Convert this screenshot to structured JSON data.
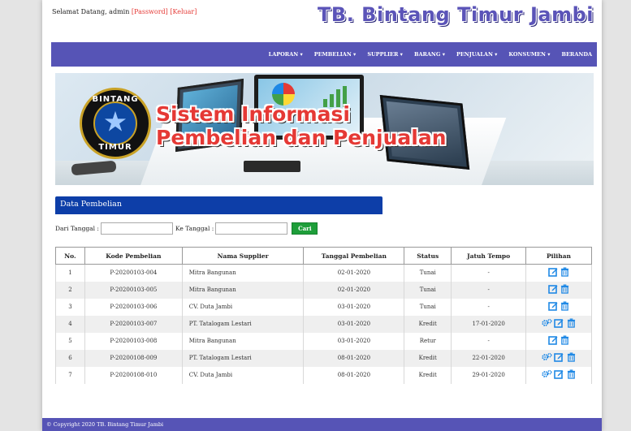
{
  "header": {
    "greeting": "Selamat Datang, admin",
    "password_link": "[Password]",
    "logout_link": "[Keluar]",
    "brand": "TB. Bintang Timur Jambi"
  },
  "nav": {
    "items": [
      {
        "label": "LAPORAN ▾"
      },
      {
        "label": "PEMBELIAN ▾"
      },
      {
        "label": "SUPPLIER ▾"
      },
      {
        "label": "BARANG ▾"
      },
      {
        "label": "PENJUALAN ▾"
      },
      {
        "label": "KONSUMEN ▾"
      },
      {
        "label": "BERANDA"
      }
    ]
  },
  "banner": {
    "logo_top": "BINTANG",
    "logo_bottom": "TIMUR",
    "title_line1": "Sistem Informasi",
    "title_line2": "Pembelian dan Penjualan"
  },
  "section": {
    "title": "Data Pembelian"
  },
  "filter": {
    "from_label": "Dari Tanggal :",
    "from_value": "",
    "to_label": "Ke Tanggal :",
    "to_value": "",
    "search_label": "Cari"
  },
  "table": {
    "columns": [
      "No.",
      "Kode Pembelian",
      "Nama Supplier",
      "Tanggal Pembelian",
      "Status",
      "Jatuh Tempo",
      "Pilihan"
    ],
    "rows": [
      {
        "no": "1",
        "kode": "P-20200103-004",
        "supplier": "Mitra Bangunan",
        "tanggal": "02-01-2020",
        "status": "Tunai",
        "jatuh_tempo": "-",
        "detail": false
      },
      {
        "no": "2",
        "kode": "P-20200103-005",
        "supplier": "Mitra Bangunan",
        "tanggal": "02-01-2020",
        "status": "Tunai",
        "jatuh_tempo": "-",
        "detail": false
      },
      {
        "no": "3",
        "kode": "P-20200103-006",
        "supplier": "CV. Duta Jambi",
        "tanggal": "03-01-2020",
        "status": "Tunai",
        "jatuh_tempo": "-",
        "detail": false
      },
      {
        "no": "4",
        "kode": "P-20200103-007",
        "supplier": "PT. Tatalogam Lestari",
        "tanggal": "03-01-2020",
        "status": "Kredit",
        "jatuh_tempo": "17-01-2020",
        "detail": true
      },
      {
        "no": "5",
        "kode": "P-20200103-008",
        "supplier": "Mitra Bangunan",
        "tanggal": "03-01-2020",
        "status": "Retur",
        "jatuh_tempo": "-",
        "detail": false
      },
      {
        "no": "6",
        "kode": "P-20200108-009",
        "supplier": "PT. Tatalogam Lestari",
        "tanggal": "08-01-2020",
        "status": "Kredit",
        "jatuh_tempo": "22-01-2020",
        "detail": true
      },
      {
        "no": "7",
        "kode": "P-20200108-010",
        "supplier": "CV. Duta Jambi",
        "tanggal": "08-01-2020",
        "status": "Kredit",
        "jatuh_tempo": "29-01-2020",
        "detail": true
      }
    ]
  },
  "footer": {
    "copyright": "© Copyright 2020 TB. Bintang Timur Jambi"
  },
  "colors": {
    "nav_bg": "#5654b6",
    "section_bg": "#0d3ea8",
    "search_button": "#1e9e3a",
    "title_red": "#e53935",
    "icon_blue": "#1e88e5"
  },
  "icons": {
    "detail": "gears-icon",
    "edit": "edit-icon",
    "delete": "trash-icon"
  }
}
